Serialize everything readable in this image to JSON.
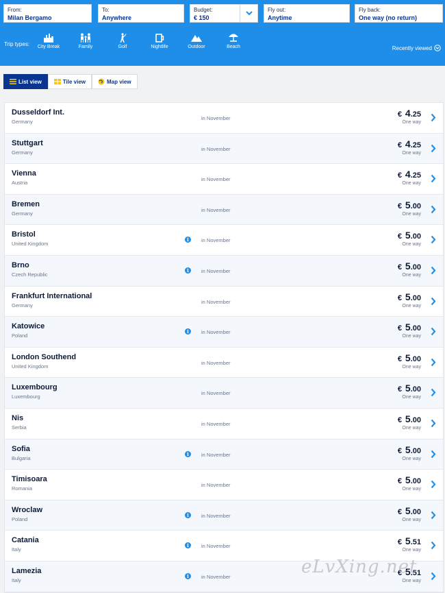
{
  "search": {
    "from": {
      "label": "From:",
      "value": "Milan Bergamo"
    },
    "to": {
      "label": "To:",
      "value": "Anywhere"
    },
    "budget": {
      "label": "Budget:",
      "value": "€ 150"
    },
    "fly_out": {
      "label": "Fly out:",
      "value": "Anytime"
    },
    "fly_back": {
      "label": "Fly back:",
      "value": "One way (no return)"
    }
  },
  "trip_types": {
    "label": "Trip types:",
    "items": [
      {
        "label": "City Break",
        "icon": "city-break-icon"
      },
      {
        "label": "Family",
        "icon": "family-icon"
      },
      {
        "label": "Golf",
        "icon": "golf-icon"
      },
      {
        "label": "Nightlife",
        "icon": "nightlife-icon"
      },
      {
        "label": "Outdoor",
        "icon": "outdoor-icon"
      },
      {
        "label": "Beach",
        "icon": "beach-icon"
      }
    ]
  },
  "recently_viewed": "Recently viewed",
  "views": {
    "list": "List view",
    "tile": "Tile view",
    "map": "Map view",
    "active": "list"
  },
  "results": [
    {
      "city": "Dusseldorf Int.",
      "country": "Germany",
      "info": false,
      "when": "in November",
      "currency": "€",
      "whole": "4",
      "decimal": ".25",
      "trip": "One way"
    },
    {
      "city": "Stuttgart",
      "country": "Germany",
      "info": false,
      "when": "in November",
      "currency": "€",
      "whole": "4",
      "decimal": ".25",
      "trip": "One way"
    },
    {
      "city": "Vienna",
      "country": "Austria",
      "info": false,
      "when": "in November",
      "currency": "€",
      "whole": "4",
      "decimal": ".25",
      "trip": "One way"
    },
    {
      "city": "Bremen",
      "country": "Germany",
      "info": false,
      "when": "in November",
      "currency": "€",
      "whole": "5",
      "decimal": ".00",
      "trip": "One way"
    },
    {
      "city": "Bristol",
      "country": "United Kingdom",
      "info": true,
      "when": "in November",
      "currency": "€",
      "whole": "5",
      "decimal": ".00",
      "trip": "One way"
    },
    {
      "city": "Brno",
      "country": "Czech Republic",
      "info": true,
      "when": "in November",
      "currency": "€",
      "whole": "5",
      "decimal": ".00",
      "trip": "One way"
    },
    {
      "city": "Frankfurt International",
      "country": "Germany",
      "info": false,
      "when": "in November",
      "currency": "€",
      "whole": "5",
      "decimal": ".00",
      "trip": "One way"
    },
    {
      "city": "Katowice",
      "country": "Poland",
      "info": true,
      "when": "in November",
      "currency": "€",
      "whole": "5",
      "decimal": ".00",
      "trip": "One way"
    },
    {
      "city": "London Southend",
      "country": "United Kingdom",
      "info": false,
      "when": "in November",
      "currency": "€",
      "whole": "5",
      "decimal": ".00",
      "trip": "One way"
    },
    {
      "city": "Luxembourg",
      "country": "Luxembourg",
      "info": false,
      "when": "in November",
      "currency": "€",
      "whole": "5",
      "decimal": ".00",
      "trip": "One way"
    },
    {
      "city": "Nis",
      "country": "Serbia",
      "info": false,
      "when": "in November",
      "currency": "€",
      "whole": "5",
      "decimal": ".00",
      "trip": "One way"
    },
    {
      "city": "Sofia",
      "country": "Bulgaria",
      "info": true,
      "when": "in November",
      "currency": "€",
      "whole": "5",
      "decimal": ".00",
      "trip": "One way"
    },
    {
      "city": "Timisoara",
      "country": "Romania",
      "info": false,
      "when": "in November",
      "currency": "€",
      "whole": "5",
      "decimal": ".00",
      "trip": "One way"
    },
    {
      "city": "Wroclaw",
      "country": "Poland",
      "info": true,
      "when": "in November",
      "currency": "€",
      "whole": "5",
      "decimal": ".00",
      "trip": "One way"
    },
    {
      "city": "Catania",
      "country": "Italy",
      "info": true,
      "when": "in November",
      "currency": "€",
      "whole": "5",
      "decimal": ".51",
      "trip": "One way"
    },
    {
      "city": "Lamezia",
      "country": "Italy",
      "info": true,
      "when": "in November",
      "currency": "€",
      "whole": "5",
      "decimal": ".51",
      "trip": "One way"
    }
  ],
  "watermark": "eLvXing.net",
  "colors": {
    "header": "#1f8ee8",
    "accent": "#073590",
    "info": "#1f8ee8"
  }
}
